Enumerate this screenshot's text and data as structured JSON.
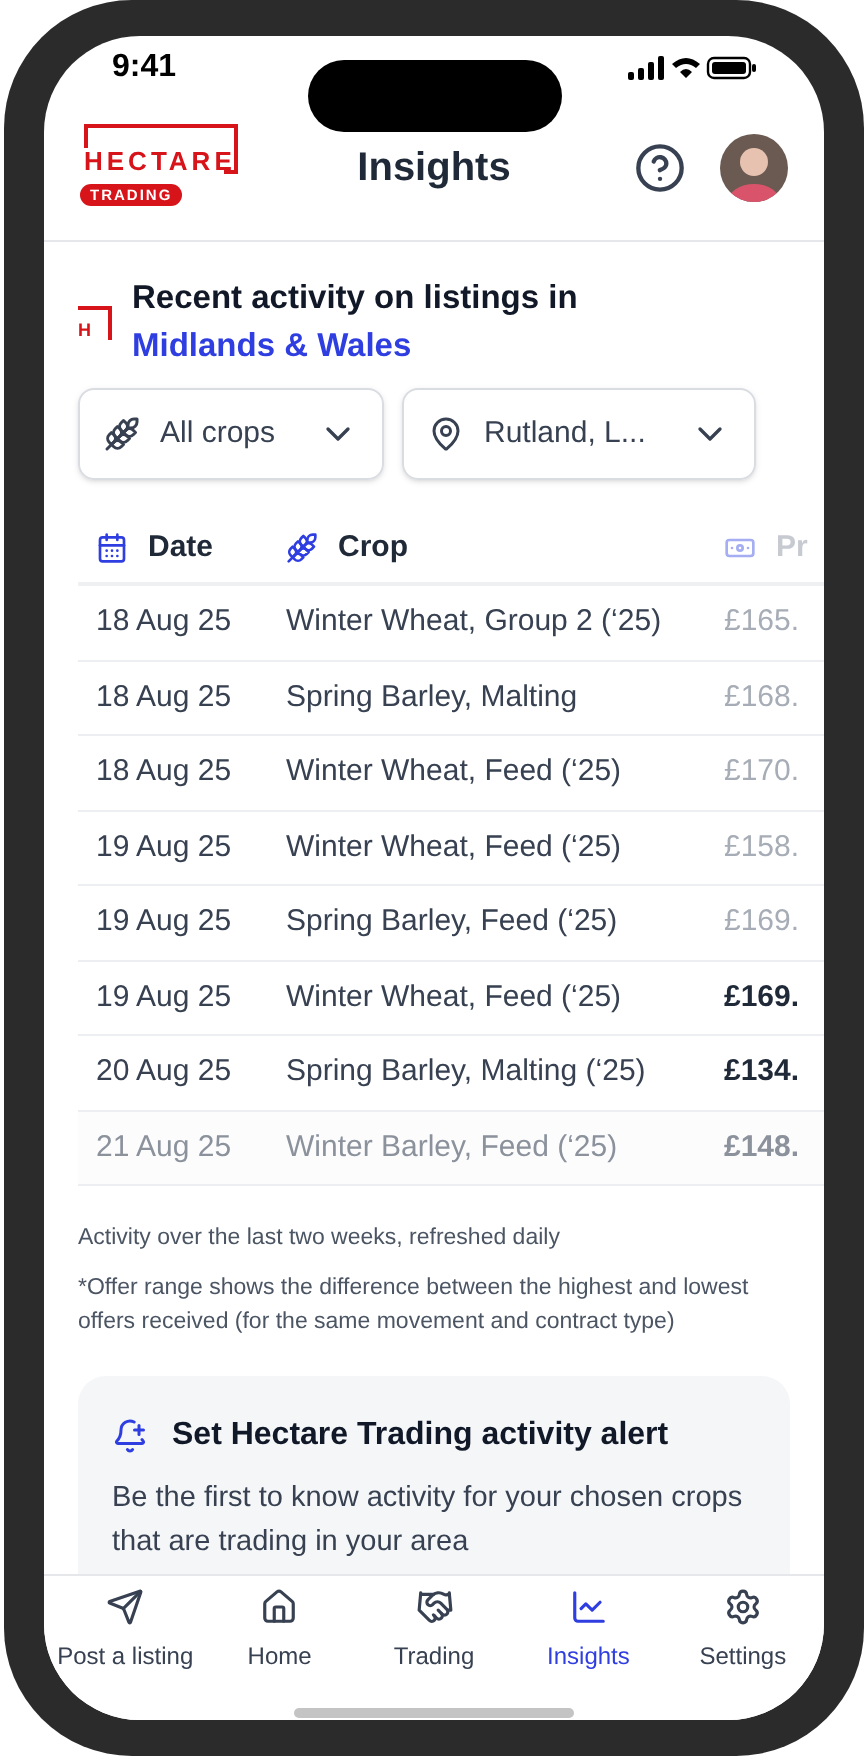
{
  "status_bar": {
    "time": "9:41"
  },
  "header": {
    "logo": {
      "name": "HECTARE",
      "badge": "TRADING"
    },
    "title": "Insights"
  },
  "section": {
    "mark": "H",
    "heading": "Recent activity on listings in",
    "region": "Midlands & Wales"
  },
  "filters": [
    {
      "kind": "crop",
      "value": "All crops"
    },
    {
      "kind": "location",
      "value": "Rutland, L..."
    }
  ],
  "table": {
    "columns": [
      {
        "kind": "date",
        "label": "Date"
      },
      {
        "kind": "crop",
        "label": "Crop"
      },
      {
        "kind": "price",
        "label": "Pr"
      }
    ],
    "rows": [
      {
        "date": "18 Aug 25",
        "crop": "Winter Wheat, Group 2 (‘25)",
        "price": "£165.",
        "price_highlighted": false,
        "faded": false
      },
      {
        "date": "18 Aug 25",
        "crop": "Spring Barley, Malting",
        "price": "£168.",
        "price_highlighted": false,
        "faded": false
      },
      {
        "date": "18 Aug 25",
        "crop": "Winter Wheat, Feed (‘25)",
        "price": "£170.",
        "price_highlighted": false,
        "faded": false
      },
      {
        "date": "19 Aug 25",
        "crop": "Winter Wheat, Feed (‘25)",
        "price": "£158.",
        "price_highlighted": false,
        "faded": false
      },
      {
        "date": "19 Aug 25",
        "crop": "Spring Barley, Feed (‘25)",
        "price": "£169.",
        "price_highlighted": false,
        "faded": false
      },
      {
        "date": "19 Aug 25",
        "crop": "Winter Wheat, Feed (‘25)",
        "price": "£169.",
        "price_highlighted": true,
        "faded": false
      },
      {
        "date": "20 Aug 25",
        "crop": "Spring Barley, Malting (‘25)",
        "price": "£134.",
        "price_highlighted": true,
        "faded": false
      },
      {
        "date": "21 Aug 25",
        "crop": "Winter Barley, Feed (‘25)",
        "price": "£148.",
        "price_highlighted": true,
        "faded": true
      }
    ]
  },
  "notes": [
    "Activity over the last two weeks, refreshed daily",
    "*Offer range shows the difference between the highest and lowest offers received (for the same movement and contract type)"
  ],
  "alert_card": {
    "title": "Set Hectare Trading activity alert",
    "body": "Be the first to know activity for your chosen crops that are trading in your area"
  },
  "nav": [
    {
      "kind": "post",
      "label": "Post a listing",
      "selected": false
    },
    {
      "kind": "home",
      "label": "Home",
      "selected": false
    },
    {
      "kind": "trading",
      "label": "Trading",
      "selected": false
    },
    {
      "kind": "insights",
      "label": "Insights",
      "selected": true
    },
    {
      "kind": "settings",
      "label": "Settings",
      "selected": false
    }
  ]
}
